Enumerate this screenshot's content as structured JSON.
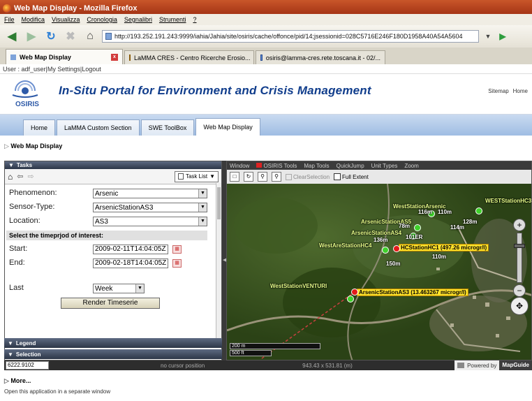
{
  "window": {
    "title": "Web Map Display - Mozilla Firefox"
  },
  "menu": {
    "items": [
      "File",
      "Modifica",
      "Visualizza",
      "Cronologia",
      "Segnalibri",
      "Strumenti",
      "?"
    ]
  },
  "nav": {
    "url": "http://193.252.191.243:9999/iahia/Jahia/site/osiris/cache/offonce/pid/14;jsessionid=028C5716E246F180D1958A40A54A5604"
  },
  "browser_tabs": [
    {
      "label": "Web Map Display",
      "active": true
    },
    {
      "label": "LaMMA CRES - Centro Ricerche Erosio...",
      "active": false
    },
    {
      "label": "osiris@lamma-cres.rete.toscana.it - 02/...",
      "active": false
    }
  ],
  "user_line": "User : adf_user|My Settings|Logout",
  "header": {
    "logo_text": "OSIRIS",
    "title": "In-Situ Portal for Environment and Crisis Management",
    "links": [
      "Sitemap",
      "Home"
    ]
  },
  "site_tabs": [
    "Home",
    "LaMMA Custom Section",
    "SWE ToolBox",
    "Web Map Display"
  ],
  "breadcrumb": "Web Map Display",
  "tasks": {
    "title": "Tasks",
    "task_list": "Task List",
    "phenomenon": {
      "label": "Phenomenon:",
      "value": "Arsenic"
    },
    "sensor_type": {
      "label": "Sensor-Type:",
      "value": "ArsenicStationAS3"
    },
    "location": {
      "label": "Location:",
      "value": "AS3"
    },
    "time_section": "Select the timeprjod of interest:",
    "start": {
      "label": "Start:",
      "value": "2009-02-11T14:04:05Z"
    },
    "end": {
      "label": "End:",
      "value": "2009-02-18T14:04:05Z"
    },
    "last": {
      "label": "Last",
      "value": "Week"
    },
    "render_button": "Render Timeserie"
  },
  "legend_title": "Legend",
  "selection_title": "Selection",
  "map": {
    "menu": [
      "Window",
      "OSIRIS Tools",
      "Map Tools",
      "QuickJump",
      "Unit Types",
      "Zoom"
    ],
    "tools": {
      "clear_selection": "ClearSelection",
      "full_extent": "Full Extent"
    },
    "stations": [
      {
        "label": "WestStationVENTURI",
        "kind": "green"
      },
      {
        "label": "ArsenicStationAS3 (13.463267 microgr/l)",
        "kind": "highlight"
      },
      {
        "label": "HCStationHC1 (497.26 microgr/l)",
        "kind": "highlight"
      },
      {
        "label": "WestAreStationHC4",
        "kind": "green"
      },
      {
        "label": "ArsenicStationAS4",
        "kind": "green"
      },
      {
        "label": "ArsenicStationAS5",
        "kind": "green"
      },
      {
        "label": "WestStationArsenic",
        "kind": "green"
      },
      {
        "label": "WESTStationHC3",
        "kind": "green"
      }
    ],
    "map_numbers": [
      "116m",
      "110m",
      "114m",
      "101ER",
      "110m",
      "136m",
      "150m",
      "128m",
      "78m"
    ],
    "scale": [
      "200 m",
      "500 ft"
    ]
  },
  "status": {
    "coord": "6222.9102",
    "cursor": "no cursor position",
    "size": "943.43 x 531.81 (m)",
    "powered_by": "Powered by",
    "brand": "MapGuide"
  },
  "more_label": "More...",
  "separate_window": "Open this application in a separate window",
  "colors": {
    "title_bar": "#b8431e",
    "header_title": "#103d8c",
    "site_tabs": "#b5cdea",
    "panel_head": "#2c3647",
    "highlight_label": "#ffe22a",
    "station_green": "#3fd12b",
    "station_red": "#e31a1a"
  }
}
